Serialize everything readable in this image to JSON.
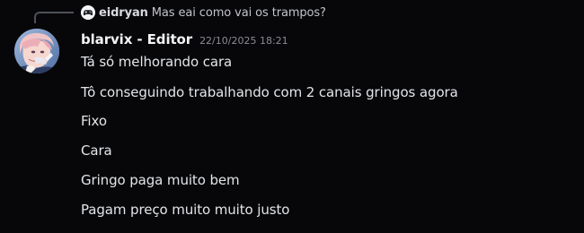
{
  "reply": {
    "username": "eidryan",
    "text": "Mas eai como vai os trampos?",
    "avatar_icon": "game-controller-icon"
  },
  "author": {
    "display": "blarvix - Editor",
    "timestamp": "22/10/2025 18:21",
    "avatar_icon": "anime-avatar"
  },
  "messages": [
    "Tá só melhorando cara",
    "Tô conseguindo trabalhando com 2 canais gringos agora",
    "Fixo",
    "Cara",
    "Gringo paga muito bem",
    "Pagam preço muito muito justo"
  ],
  "colors": {
    "background": "#070709",
    "text": "#e3e5e8",
    "muted": "#8a8d94"
  }
}
